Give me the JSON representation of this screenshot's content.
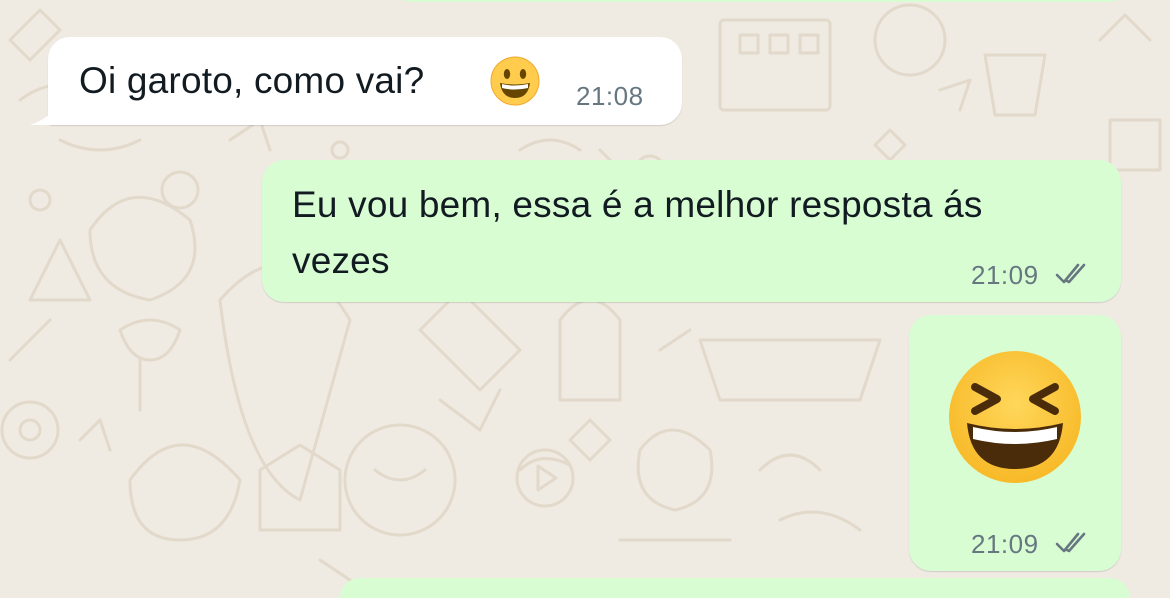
{
  "chat": {
    "messages": [
      {
        "direction": "incoming",
        "text": "Oi garoto, como vai?",
        "emoji": "grinning-face",
        "time": "21:08"
      },
      {
        "direction": "outgoing",
        "text_line1": "Eu vou bem, essa é a melhor resposta ás",
        "text_line2": "vezes",
        "time": "21:09",
        "status": "read"
      },
      {
        "direction": "outgoing",
        "emoji": "grinning-squinting-face",
        "time": "21:09",
        "status": "read"
      }
    ]
  },
  "colors": {
    "background": "#efeae2",
    "incoming_bubble": "#ffffff",
    "outgoing_bubble": "#d9fdd3",
    "timestamp": "#667781",
    "text": "#111b21"
  }
}
